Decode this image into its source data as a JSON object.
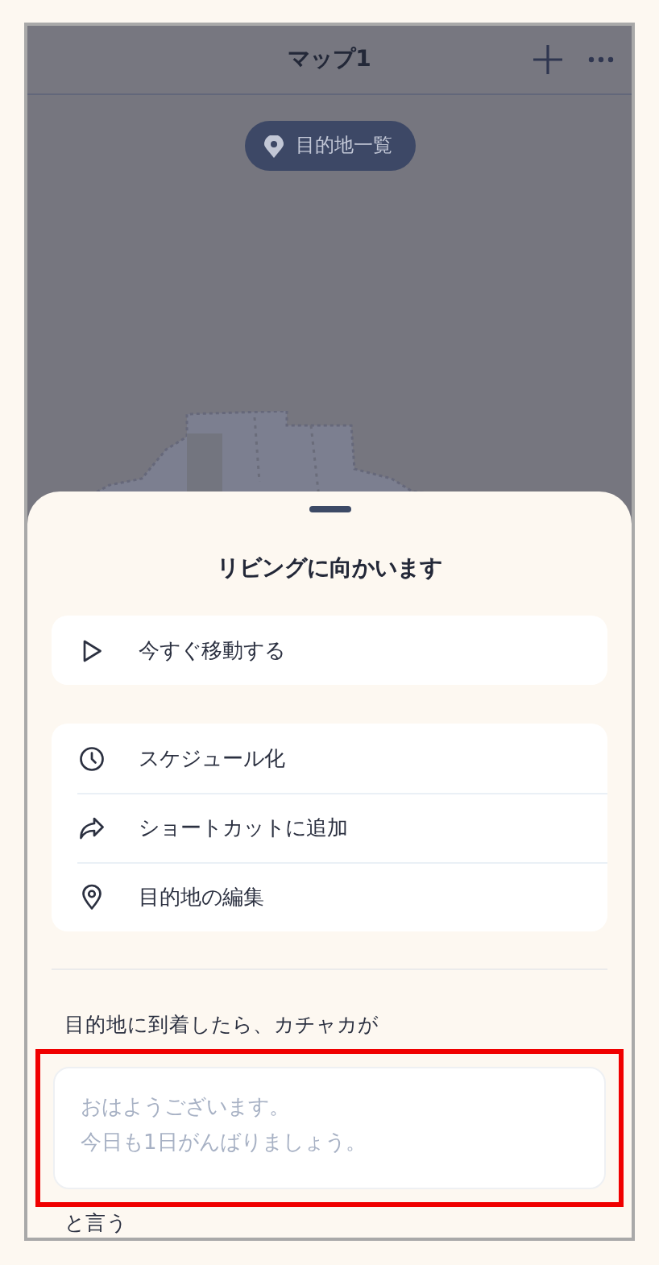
{
  "header": {
    "title": "マップ1"
  },
  "destinations_button": {
    "label": "目的地一覧"
  },
  "sheet": {
    "title": "リビングに向かいます",
    "groups": [
      [
        {
          "kind": "play",
          "label": "今すぐ移動する"
        }
      ],
      [
        {
          "kind": "clock",
          "label": "スケジュール化"
        },
        {
          "kind": "share",
          "label": "ショートカットに追加"
        },
        {
          "kind": "pin",
          "label": "目的地の編集"
        }
      ]
    ],
    "message": {
      "prompt": "目的地に到着したら、カチャカが",
      "placeholder": [
        "おはようございます。",
        "今日も1日がんばりましょう。"
      ],
      "highlighted": true,
      "suffix": "と言う"
    }
  }
}
